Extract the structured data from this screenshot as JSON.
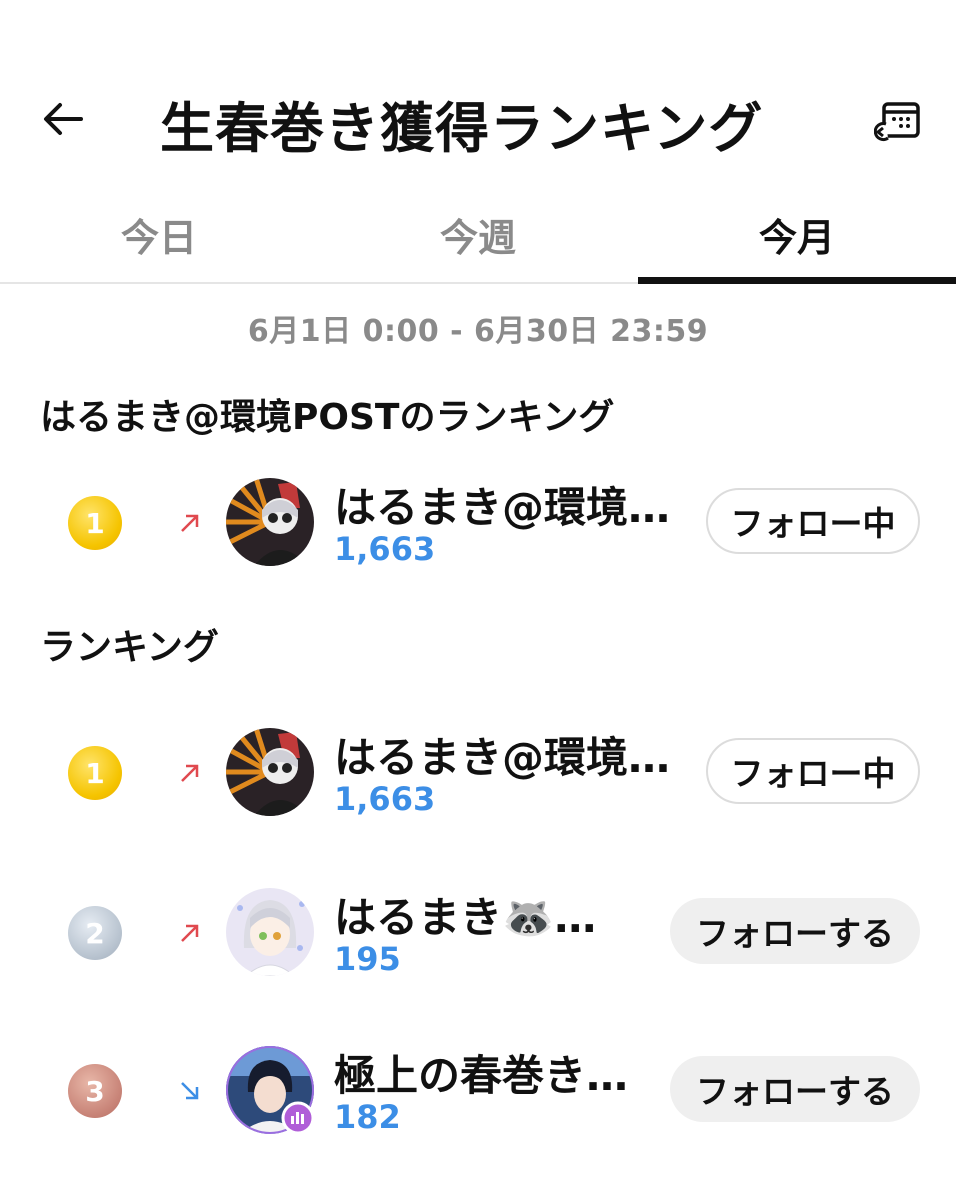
{
  "header": {
    "title": "生春巻き獲得ランキング"
  },
  "tabs": [
    {
      "label": "今日",
      "active": false
    },
    {
      "label": "今週",
      "active": false
    },
    {
      "label": "今月",
      "active": true
    }
  ],
  "date_range": "6月1日 0:00 - 6月30日 23:59",
  "my_section": {
    "title": "はるまき@環境POSTのランキング",
    "row": {
      "rank": "1",
      "trend": "up",
      "name": "はるまき@環境…",
      "score": "1,663",
      "button": "フォロー中"
    }
  },
  "ranking_section": {
    "title": "ランキング",
    "rows": [
      {
        "rank": "1",
        "trend": "up",
        "name": "はるまき@環境…",
        "score": "1,663",
        "button": "フォロー中"
      },
      {
        "rank": "2",
        "trend": "up",
        "name": "はるまき🦝…",
        "score": "195",
        "button": "フォローする"
      },
      {
        "rank": "3",
        "trend": "down",
        "name": "極上の春巻き…",
        "score": "182",
        "button": "フォローする"
      }
    ]
  },
  "colors": {
    "score": "#3c8ee6",
    "trend_up": "#e0494f",
    "trend_down": "#3c8ee6",
    "gold": "#f5c400",
    "silver": "#b9c4d0",
    "bronze": "#c98579"
  }
}
